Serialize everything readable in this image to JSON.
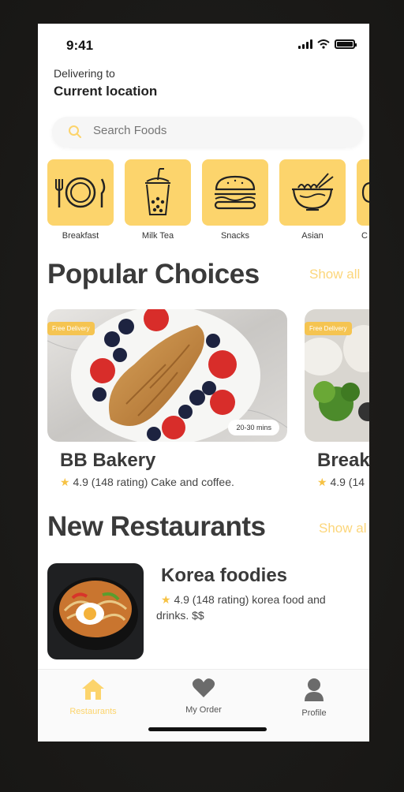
{
  "status": {
    "time": "9:41"
  },
  "header": {
    "delivering_label": "Delivering to",
    "location": "Current location"
  },
  "search": {
    "placeholder": "Search Foods"
  },
  "categories": [
    {
      "label": "Breakfast",
      "icon": "plate-cutlery-icon"
    },
    {
      "label": "Milk Tea",
      "icon": "bubble-tea-icon"
    },
    {
      "label": "Snacks",
      "icon": "burger-icon"
    },
    {
      "label": "Asian",
      "icon": "noodle-bowl-icon"
    },
    {
      "label": "C",
      "icon": "partial-icon"
    }
  ],
  "popular": {
    "title": "Popular Choices",
    "show_all": "Show all",
    "cards": [
      {
        "name": "BB Bakery",
        "rating": "4.9 (148 rating) Cake and coffee.",
        "badge": "Free Delivery",
        "time": "20-30 mins"
      },
      {
        "name": "Break",
        "rating": "4.9 (14",
        "badge": "Free Delivery"
      }
    ]
  },
  "new_restaurants": {
    "title": "New Restaurants",
    "show_all": "Show al",
    "items": [
      {
        "name": "Korea foodies",
        "rating_line1": "4.9 (148 rating) korea food and",
        "rating_line2": "drinks. $$"
      }
    ]
  },
  "tabs": [
    {
      "label": "Restaurants",
      "icon": "home-icon",
      "active": true
    },
    {
      "label": "My Order",
      "icon": "heart-icon",
      "active": false
    },
    {
      "label": "Profile",
      "icon": "user-icon",
      "active": false
    }
  ],
  "colors": {
    "accent": "#fcd46c",
    "text_dark": "#3a3a3a",
    "star": "#f6c244"
  }
}
